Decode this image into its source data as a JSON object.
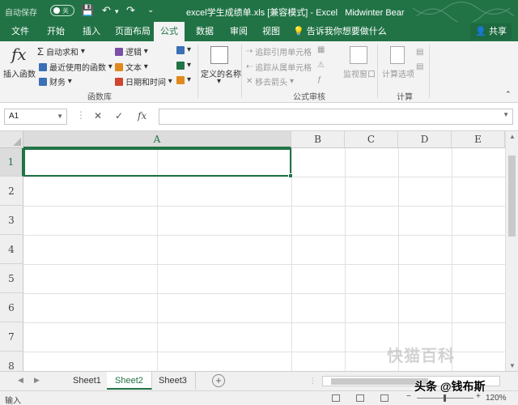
{
  "titlebar": {
    "autosave_label": "自动保存",
    "autosave_state": "关",
    "doc_title": "excel学生成绩单.xls [兼容模式] - Excel",
    "user": "Midwinter Bear"
  },
  "tabs": [
    "文件",
    "开始",
    "插入",
    "页面布局",
    "公式",
    "数据",
    "审阅",
    "视图"
  ],
  "active_tab": "公式",
  "tell_me": "告诉我你想要做什么",
  "share": "共享",
  "ribbon": {
    "insert_function": "插入函数",
    "autosum": "自动求和",
    "recent": "最近使用的函数",
    "financial": "财务",
    "logical": "逻辑",
    "text": "文本",
    "datetime": "日期和时间",
    "group_library": "函数库",
    "defined_names": "定义的名称",
    "trace_precedents": "追踪引用单元格",
    "trace_dependents": "追踪从属单元格",
    "remove_arrows": "移去箭头",
    "group_audit": "公式审核",
    "watch_window": "监视窗口",
    "calc_options": "计算选项",
    "group_calc": "计算"
  },
  "formula_bar": {
    "name_box": "A1",
    "cancel_icon": "✕",
    "enter_icon": "✓",
    "fx_icon": "fx",
    "value": ""
  },
  "grid": {
    "columns": [
      "A",
      "B",
      "C",
      "D",
      "E"
    ],
    "rows": [
      "1",
      "2",
      "3",
      "4",
      "5",
      "6",
      "7",
      "8"
    ],
    "selected_column": "A",
    "selected_row": "1"
  },
  "sheets": [
    "Sheet1",
    "Sheet2",
    "Sheet3"
  ],
  "active_sheet": "Sheet2",
  "status": {
    "mode": "输入",
    "zoom": "120%"
  },
  "watermarks": {
    "site": "快猫百科",
    "author": "头条 @钱布斯"
  },
  "colors": {
    "accent": "#217346",
    "ribbon_bg": "#f3f3f3",
    "grid_line": "#e1e1e1"
  }
}
